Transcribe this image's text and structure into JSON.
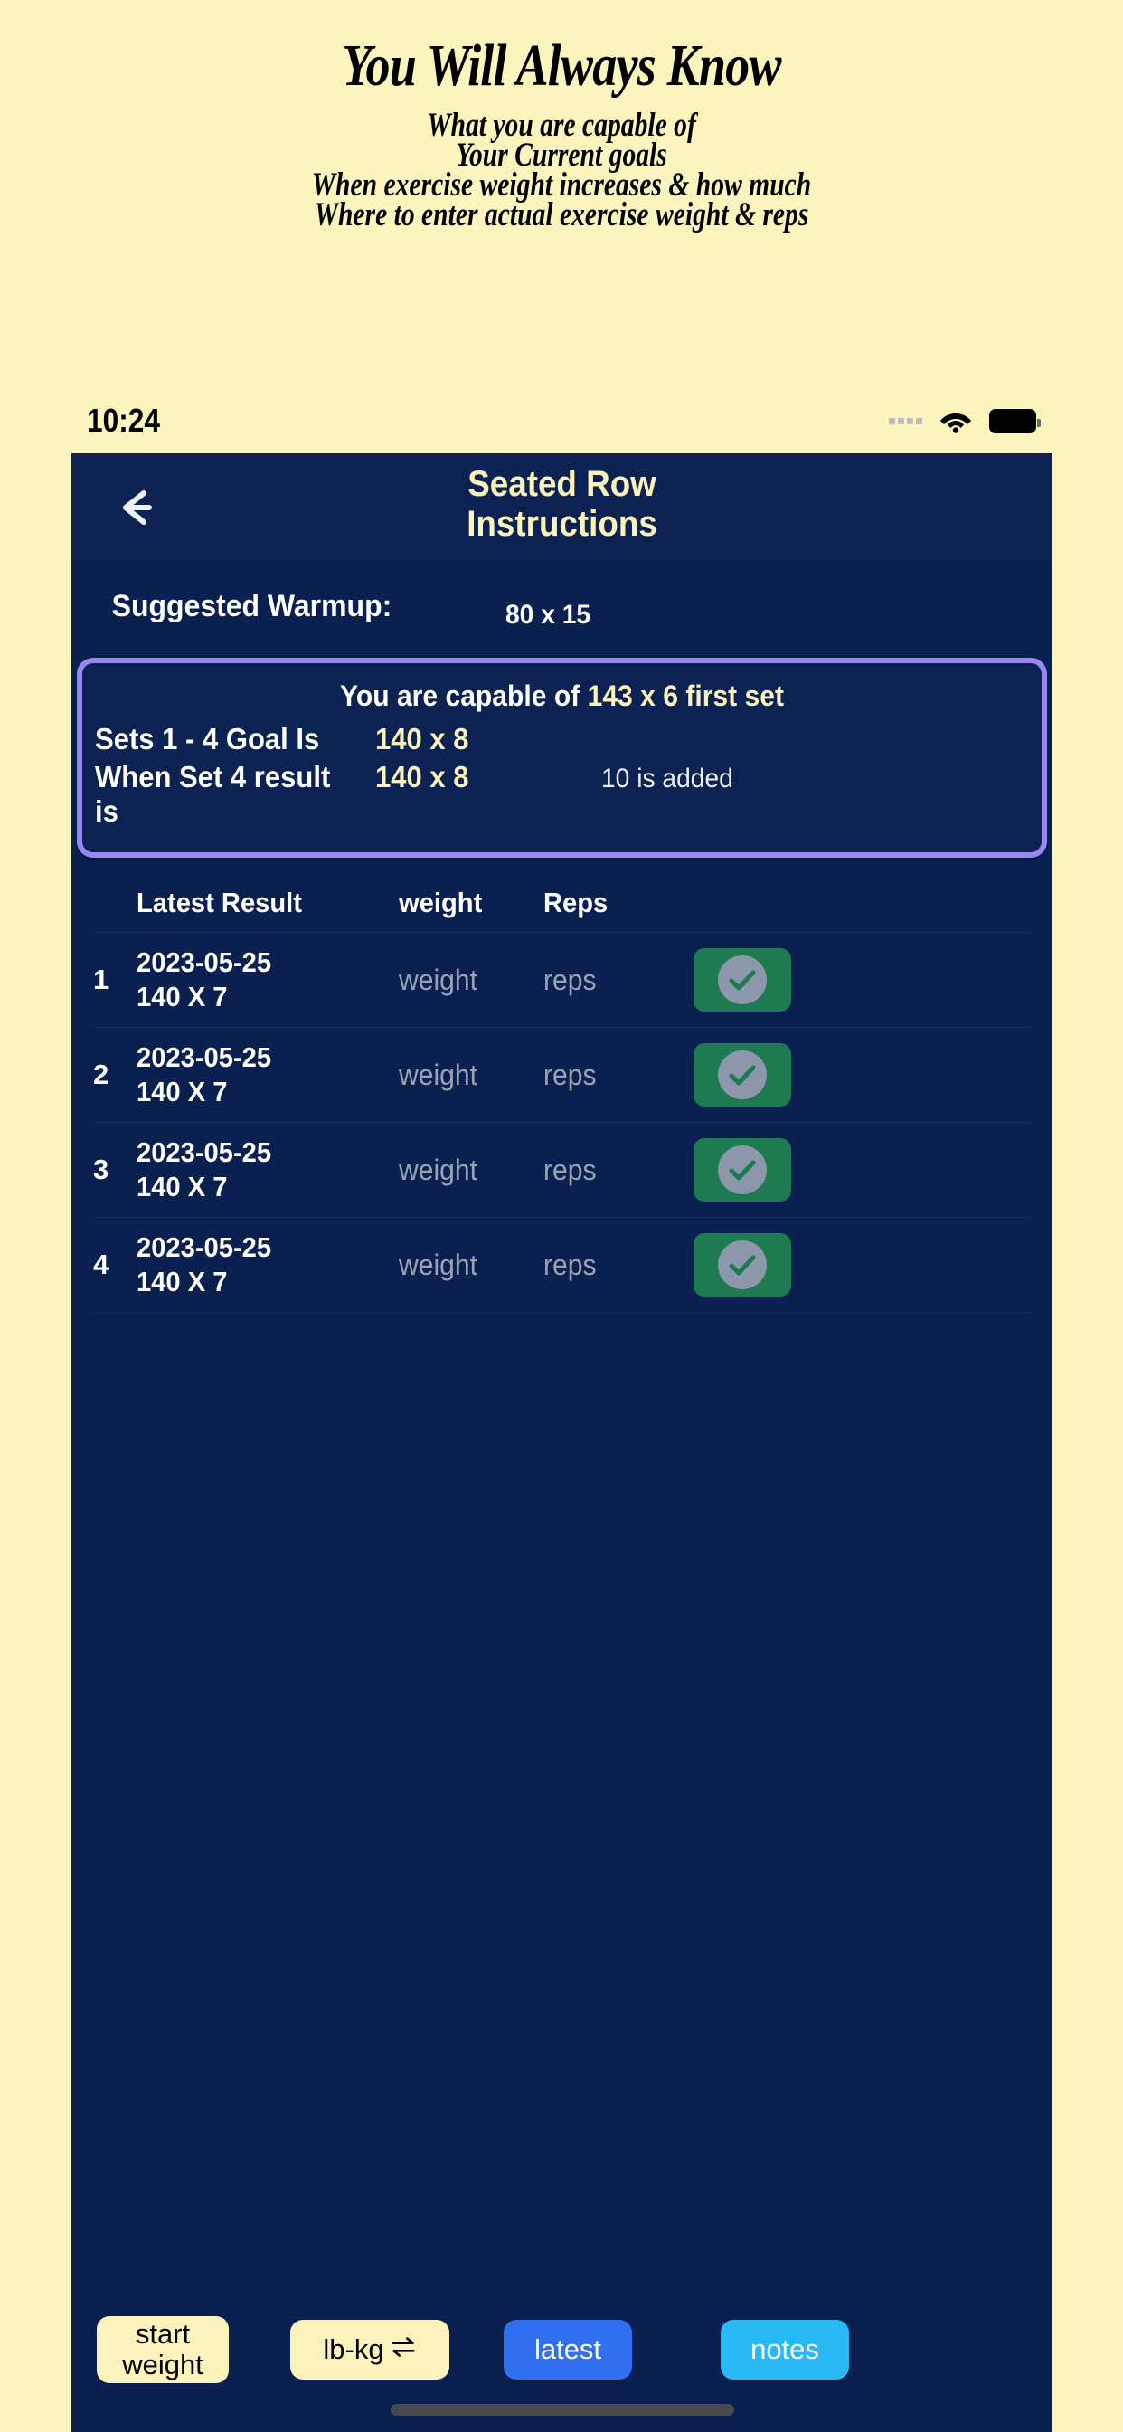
{
  "banner": {
    "title": "You Will Always Know",
    "lines": [
      "What you are capable of",
      "Your Current goals",
      "When exercise weight increases & how much",
      "Where to enter actual exercise weight & reps"
    ]
  },
  "status_bar": {
    "time": "10:24",
    "signal_icon": "signal-dots-icon",
    "wifi_icon": "wifi-icon",
    "battery_icon": "battery-icon"
  },
  "header": {
    "back_icon": "back-arrow-icon",
    "title_line1": "Seated Row",
    "title_line2": "Instructions"
  },
  "warmup": {
    "label": "Suggested Warmup:",
    "value": "80 x 15"
  },
  "goal_card": {
    "capable_prefix": "You are capable of ",
    "capable_value": "143 x 6 first set",
    "rows": [
      {
        "label": "Sets 1 - 4 Goal Is",
        "value": "140 x 8",
        "note": ""
      },
      {
        "label": "When Set 4 result is",
        "value": "140 x 8",
        "note": "10 is added"
      }
    ],
    "border_color": "#9a86f0"
  },
  "table": {
    "headers": {
      "index": "",
      "result": "Latest Result",
      "weight": "weight",
      "reps": "Reps"
    },
    "rows": [
      {
        "index": "1",
        "date": "2023-05-25",
        "result": "140 X 7",
        "weight_placeholder": "weight",
        "reps_placeholder": "reps",
        "check_icon": "check-circle-icon"
      },
      {
        "index": "2",
        "date": "2023-05-25",
        "result": "140 X 7",
        "weight_placeholder": "weight",
        "reps_placeholder": "reps",
        "check_icon": "check-circle-icon"
      },
      {
        "index": "3",
        "date": "2023-05-25",
        "result": "140 X 7",
        "weight_placeholder": "weight",
        "reps_placeholder": "reps",
        "check_icon": "check-circle-icon"
      },
      {
        "index": "4",
        "date": "2023-05-25",
        "result": "140 X 7",
        "weight_placeholder": "weight",
        "reps_placeholder": "reps",
        "check_icon": "check-circle-icon"
      }
    ]
  },
  "bottom_bar": {
    "start_weight_line1": "start",
    "start_weight_line2": "weight",
    "lbkg_label": "lb-kg",
    "lbkg_icon": "swap-arrows-icon",
    "latest_label": "latest",
    "notes_label": "notes"
  },
  "colors": {
    "page_background": "#fbf5bd",
    "app_background": "#0a2050",
    "accent_yellow": "#fbf3bb",
    "accent_purple": "#9a86f0",
    "green_check": "#1d7a51",
    "blue_latest": "#2f6ff0",
    "blue_notes": "#29baf5"
  }
}
